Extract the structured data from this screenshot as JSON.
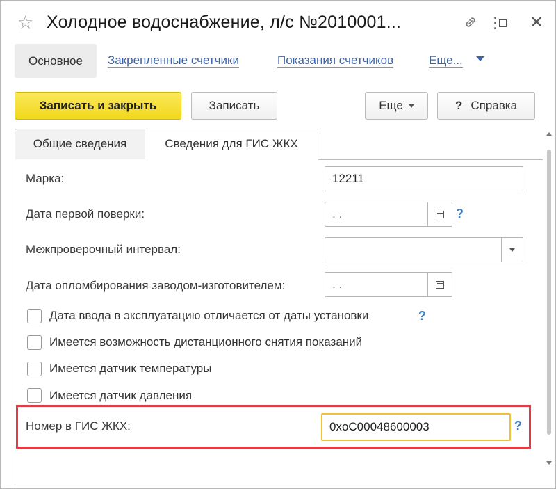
{
  "window": {
    "title": "Холодное водоснабжение, л/с №2010001..."
  },
  "nav": {
    "active": "Основное",
    "links": [
      "Закрепленные счетчики",
      "Показания счетчиков",
      "Еще..."
    ]
  },
  "toolbar": {
    "save_close": "Записать и закрыть",
    "save": "Записать",
    "more": "Еще",
    "help_icon": "?",
    "help": "Справка"
  },
  "tabs": [
    "Общие сведения",
    "Сведения для ГИС ЖКХ"
  ],
  "form": {
    "brand_label": "Марка:",
    "brand_value": "12211",
    "first_check_label": "Дата первой поверки:",
    "first_check_value": " .  .",
    "interval_label": "Межпроверочный интервал:",
    "interval_value": "",
    "seal_date_label": "Дата опломбирования заводом-изготовителем:",
    "seal_date_value": " .  .",
    "help_mark": "?",
    "checkboxes": [
      {
        "label": "Дата ввода в эксплуатацию отличается от даты установки",
        "checked": false
      },
      {
        "label": "Имеется возможность дистанционного снятия показаний",
        "checked": false
      },
      {
        "label": "Имеется датчик температуры",
        "checked": false
      },
      {
        "label": "Имеется датчик давления",
        "checked": false
      }
    ],
    "gis_label": "Номер в ГИС ЖКХ:",
    "gis_value": "0xoC00048600003"
  },
  "colors": {
    "accent_yellow": "#f2d81c",
    "link_blue": "#3b63a8",
    "highlight_red": "#e03c45",
    "focus_yellow": "#efc235"
  },
  "icons": {
    "favorite": "star-icon",
    "link": "link-icon",
    "menu": "more-icon",
    "maximize": "maximize-icon",
    "close": "close-icon",
    "calendar": "calendar-icon",
    "dropdown": "chevron-down-icon"
  }
}
